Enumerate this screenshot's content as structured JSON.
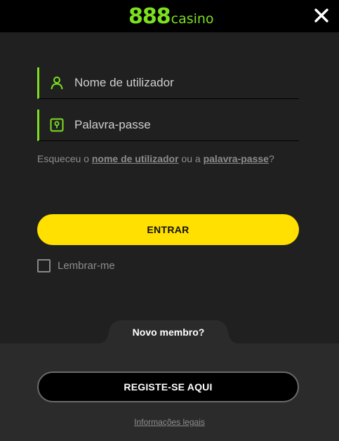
{
  "brand": {
    "logo_number": "888",
    "logo_word": "casino",
    "accent_color": "#7ce020"
  },
  "header": {
    "close_icon": "close-x-icon"
  },
  "login": {
    "username_placeholder": "Nome de utilizador",
    "password_placeholder": "Palavra-passe",
    "username_icon": "user-icon",
    "password_icon": "lock-keyhole-icon",
    "forgot_prefix": "Esqueceu o ",
    "forgot_username_link": "nome de utilizador",
    "forgot_middle": " ou a ",
    "forgot_password_link": "palavra-passe",
    "forgot_suffix": "?",
    "submit_label": "ENTRAR",
    "submit_color": "#ffe000",
    "remember_label": "Lembrar-me"
  },
  "register": {
    "tab_label": "Novo membro?",
    "button_label": "REGISTE-SE AQUI"
  },
  "footer": {
    "legal_link": "Informações legais"
  }
}
